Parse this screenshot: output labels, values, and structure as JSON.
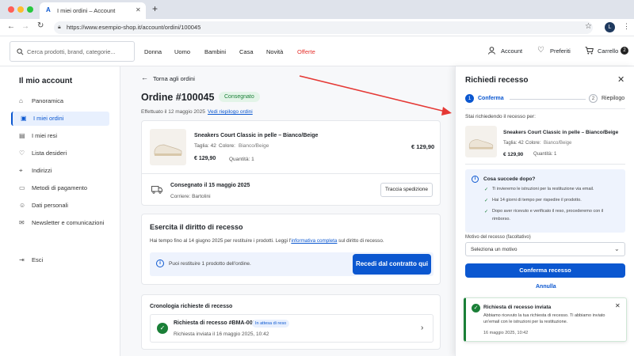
{
  "browser": {
    "tab_title": "I miei ordini – Account",
    "url": "https://www.esempio-shop.it/account/ordini/100045"
  },
  "header": {
    "search_placeholder": "Cerca prodotti, brand, categorie...",
    "nav": [
      "Donna",
      "Uomo",
      "Bambini",
      "Casa",
      "Novità",
      "Offerte"
    ],
    "account_label": "Account",
    "wishlist_label": "Preferiti",
    "cart_label": "Carrello",
    "cart_count": "2"
  },
  "sidebar": {
    "title": "Il mio account",
    "items": [
      {
        "label": "Panoramica",
        "icon": "home-icon"
      },
      {
        "label": "I miei ordini",
        "icon": "bag-icon"
      },
      {
        "label": "I miei resi",
        "icon": "return-icon"
      },
      {
        "label": "Lista desideri",
        "icon": "heart-icon"
      },
      {
        "label": "Indirizzi",
        "icon": "pin-icon"
      },
      {
        "label": "Metodi di pagamento",
        "icon": "card-icon"
      },
      {
        "label": "Dati personali",
        "icon": "user-icon"
      },
      {
        "label": "Newsletter e comunicazioni",
        "icon": "mail-icon"
      }
    ],
    "logout_label": "Esci"
  },
  "order": {
    "back_label": "Torna agli ordini",
    "title": "Ordine #100045",
    "status": "Consegnato",
    "date": "Effettuato il 12 maggio 2025",
    "summary_link": "Vedi riepilogo ordini",
    "product_name": "Sneakers Court Classic in pelle – Bianco/Beige",
    "size_label": "Taglia: 42",
    "color_label": "Colore:",
    "color_value": "Bianco/Beige",
    "unit_price": "€ 129,90",
    "quantity": "Quantità: 1",
    "line_total": "€ 129,90",
    "delivered": "Consegnato il 15 maggio 2025",
    "carrier": "Corriere: Bartolini",
    "track_label": "Traccia spedizione"
  },
  "withdrawal": {
    "title": "Esercita il diritto di recesso",
    "text_before": "Hai tempo fino al 14 giugno 2025 per restituire i prodotti. Leggi l'",
    "text_link": "informativa completa",
    "text_after": " sul diritto di recesso.",
    "info": "Puoi restituire 1 prodotto dell'ordine.",
    "cta": "Recedi dal contratto qui"
  },
  "history": {
    "title": "Cronologia richieste di recesso",
    "item_title": "Richiesta di recesso #BMA-00817",
    "item_badge": "In attesa di reso",
    "item_date": "Richiesta inviata il 16 maggio 2025, 10:42"
  },
  "panel": {
    "title": "Richiedi recesso",
    "step1_num": "1",
    "step1_label": "Conferma",
    "step2_num": "2",
    "step2_label": "Riepilogo",
    "for_label": "Stai richiedendo il recesso per:",
    "product_name": "Sneakers Court Classic in pelle – Bianco/Beige",
    "size_label": "Taglia: 42",
    "color_label": "Colore:",
    "color_value": "Bianco/Beige",
    "price": "€ 129,90",
    "quantity": "Quantità: 1",
    "info_title": "Cosa succede dopo?",
    "info_items": [
      "Ti invieremo le istruzioni per la restituzione via email.",
      "Hai 14 giorni di tempo per rispedire il prodotto.",
      "Dopo aver ricevuto e verificato il reso, procederemo con il",
      "rimborso."
    ],
    "reason_label": "Motivo del recesso (facoltativo)",
    "reason_placeholder": "Seleziona un motivo",
    "confirm_label": "Conferma recesso",
    "cancel_label": "Annulla",
    "toast_title": "Richiesta di recesso inviata",
    "toast_line1": "Abbiamo ricevuto la tua richiesta di recesso. Ti abbiamo inviato",
    "toast_line2": "un'email con le istruzioni per la restituzione.",
    "toast_date": "16 maggio 2025, 10:42"
  },
  "colors": {
    "accent": "#0b57d0",
    "offer": "#e5322d",
    "success": "#1a7f37",
    "annotation_arrow": "#e53935"
  }
}
